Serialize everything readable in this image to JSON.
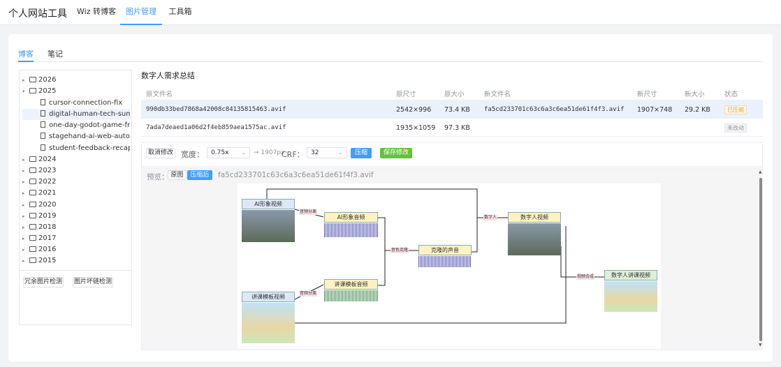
{
  "app": {
    "title": "个人网站工具"
  },
  "nav": [
    {
      "label": "Wiz 转博客",
      "active": false
    },
    {
      "label": "图片管理",
      "active": true
    },
    {
      "label": "工具箱",
      "active": false
    }
  ],
  "tabs": [
    {
      "label": "博客",
      "active": true
    },
    {
      "label": "笔记",
      "active": false
    }
  ],
  "tree": {
    "folders_top": [
      "2026",
      "2025"
    ],
    "files_2025": [
      "cursor-connection-fix",
      "digital-human-tech-summary",
      "one-day-godot-game-from-sc",
      "stagehand-ai-web-automatio",
      "student-feedback-recap"
    ],
    "selected": "digital-human-tech-summary",
    "folders_bottom": [
      "2024",
      "2023",
      "2022",
      "2021",
      "2020",
      "2019",
      "2018",
      "2017",
      "2016",
      "2015"
    ],
    "buttons": [
      "冗余图片检测",
      "图片坏链检测"
    ]
  },
  "post": {
    "title": "数字人需求总结"
  },
  "table": {
    "headers": [
      "原文件名",
      "原尺寸",
      "原大小",
      "新文件名",
      "新尺寸",
      "新大小",
      "状态"
    ],
    "rows": [
      {
        "orig_name": "990db33bed7868a42008c84135815463.avif",
        "orig_dim": "2542×996",
        "orig_size": "73.4 KB",
        "new_name": "fa5cd233701c63c6a3c6ea51de61f4f3.avif",
        "new_dim": "1907×748",
        "new_size": "29.2 KB",
        "status": "已压缩",
        "status_type": "done"
      },
      {
        "orig_name": "7ada7deaed1a06d2f4eb859aea1575ac.avif",
        "orig_dim": "1935×1059",
        "orig_size": "97.3 KB",
        "new_name": "",
        "new_dim": "",
        "new_size": "",
        "status": "未改动",
        "status_type": "none"
      }
    ]
  },
  "toolbar": {
    "cancel": "取消修改",
    "width_label": "宽度：",
    "width_value": "0.75x",
    "width_result": "→ 1907px",
    "crf_label": "CRF：",
    "crf_value": "32",
    "compress": "压缩",
    "save": "保存修改"
  },
  "preview": {
    "label": "预览：",
    "original_btn": "原图",
    "compressed_btn": "压缩后",
    "filename": "fa5cd233701c63c6a3c6ea51de61f4f3.avif"
  },
  "diagram": {
    "nodes": {
      "ai_video": "AI形象视频",
      "ai_audio": "AI形象音频",
      "clone_voice": "克隆的声音",
      "digital_video": "数字人视频",
      "lecture_template": "讲课模板视频",
      "template_audio": "讲课模板音频",
      "final": "数字人讲课视频"
    },
    "edges": {
      "split1": "音频分离",
      "split2": "音频分离",
      "clone": "音色克隆",
      "digital": "数字人",
      "compose": "视频合成"
    }
  },
  "colors": {
    "accent": "#409eff",
    "success": "#67c23a",
    "warning": "#e6a23c"
  }
}
